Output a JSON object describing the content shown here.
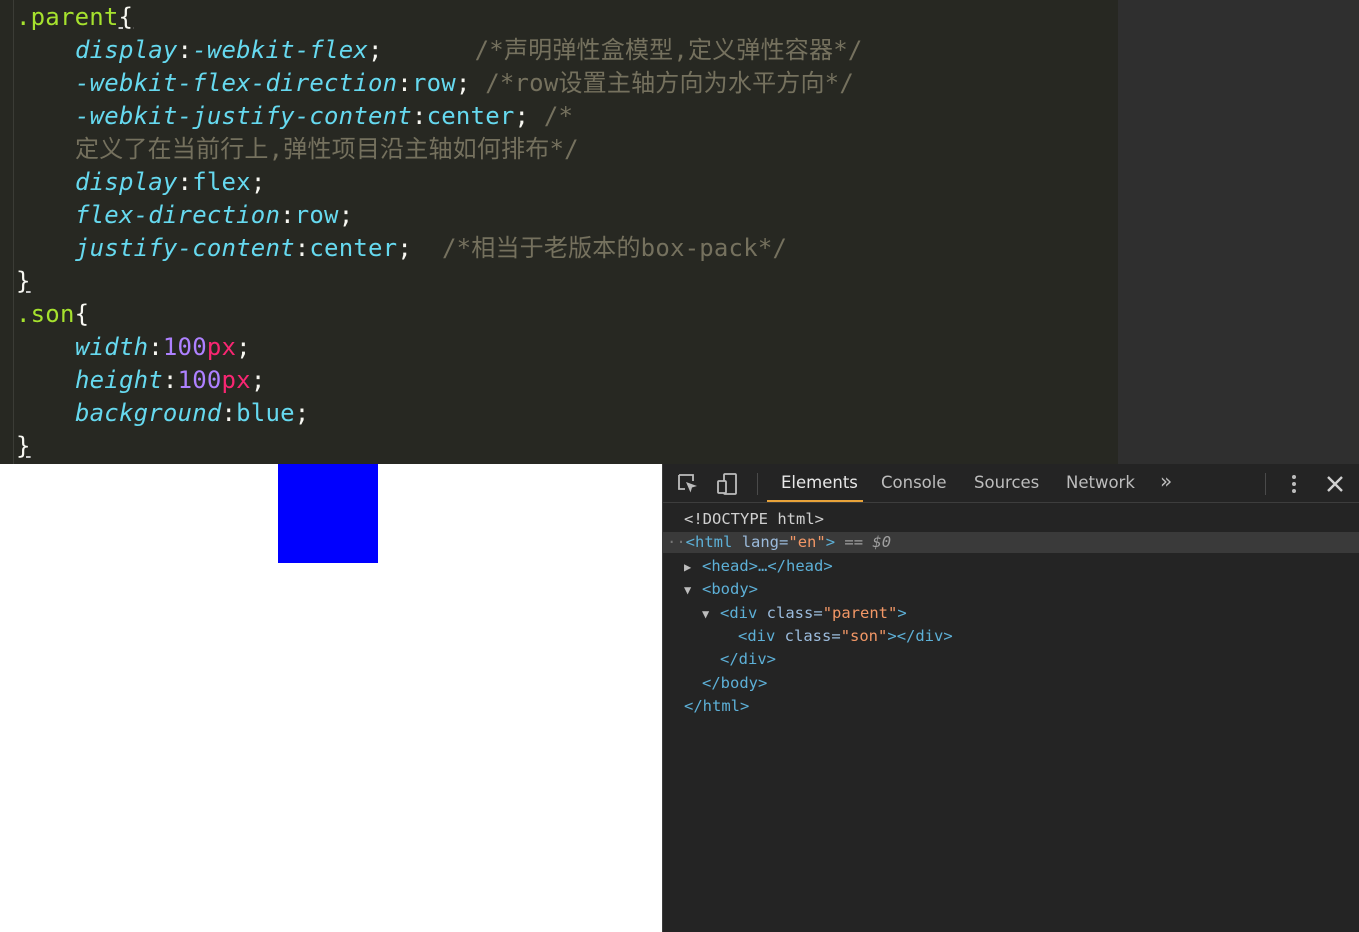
{
  "editor": {
    "selector_parent": ".parent",
    "selector_son": ".son",
    "open_brace": "{",
    "close_brace": "}",
    "colon": ":",
    "semicolon": ";",
    "lines": {
      "l1": {
        "prop": "display",
        "value": "-webkit-flex",
        "comment": "/*声明弹性盒模型,定义弹性容器*/"
      },
      "l2": {
        "prop": "-webkit-flex-direction",
        "value": "row",
        "comment": "/*row设置主轴方向为水平方向*/"
      },
      "l3": {
        "prop": "-webkit-justify-content",
        "value": "center",
        "comment_start": "/*"
      },
      "l3b": {
        "comment_cont": "定义了在当前行上,弹性项目沿主轴如何排布*/"
      },
      "l4": {
        "prop": "display",
        "value": "flex"
      },
      "l5": {
        "prop": "flex-direction",
        "value": "row"
      },
      "l6": {
        "prop": "justify-content",
        "value": "center",
        "comment": "/*相当于老版本的box-pack*/"
      },
      "s1": {
        "prop": "width",
        "num": "100",
        "unit": "px"
      },
      "s2": {
        "prop": "height",
        "num": "100",
        "unit": "px"
      },
      "s3": {
        "prop": "background",
        "value": "blue"
      }
    }
  },
  "page": {
    "son_color": "#0000ff"
  },
  "devtools": {
    "tabs": {
      "elements": "Elements",
      "console": "Console",
      "sources": "Sources",
      "network": "Network",
      "more": "»"
    },
    "icons": {
      "inspect": "inspect-element-icon",
      "device": "device-toolbar-icon",
      "menu": "kebab-menu-icon",
      "close": "close-icon"
    },
    "dom": {
      "doctype": "<!DOCTYPE html>",
      "html_open": "<html",
      "lang_attr": "lang",
      "lang_val": "\"en\"",
      "html_close_bracket": ">",
      "eq": "==",
      "dollar0": "$0",
      "head": "<head>…</head>",
      "body_open": "<body>",
      "div_open": "<div",
      "class_attr": "class",
      "parent_val": "\"parent\"",
      "son_val": "\"son\"",
      "div_close_inline": "></div>",
      "div_close": "</div>",
      "body_close": "</body>",
      "html_close": "</html>",
      "gt": ">",
      "eqsign": "="
    }
  }
}
